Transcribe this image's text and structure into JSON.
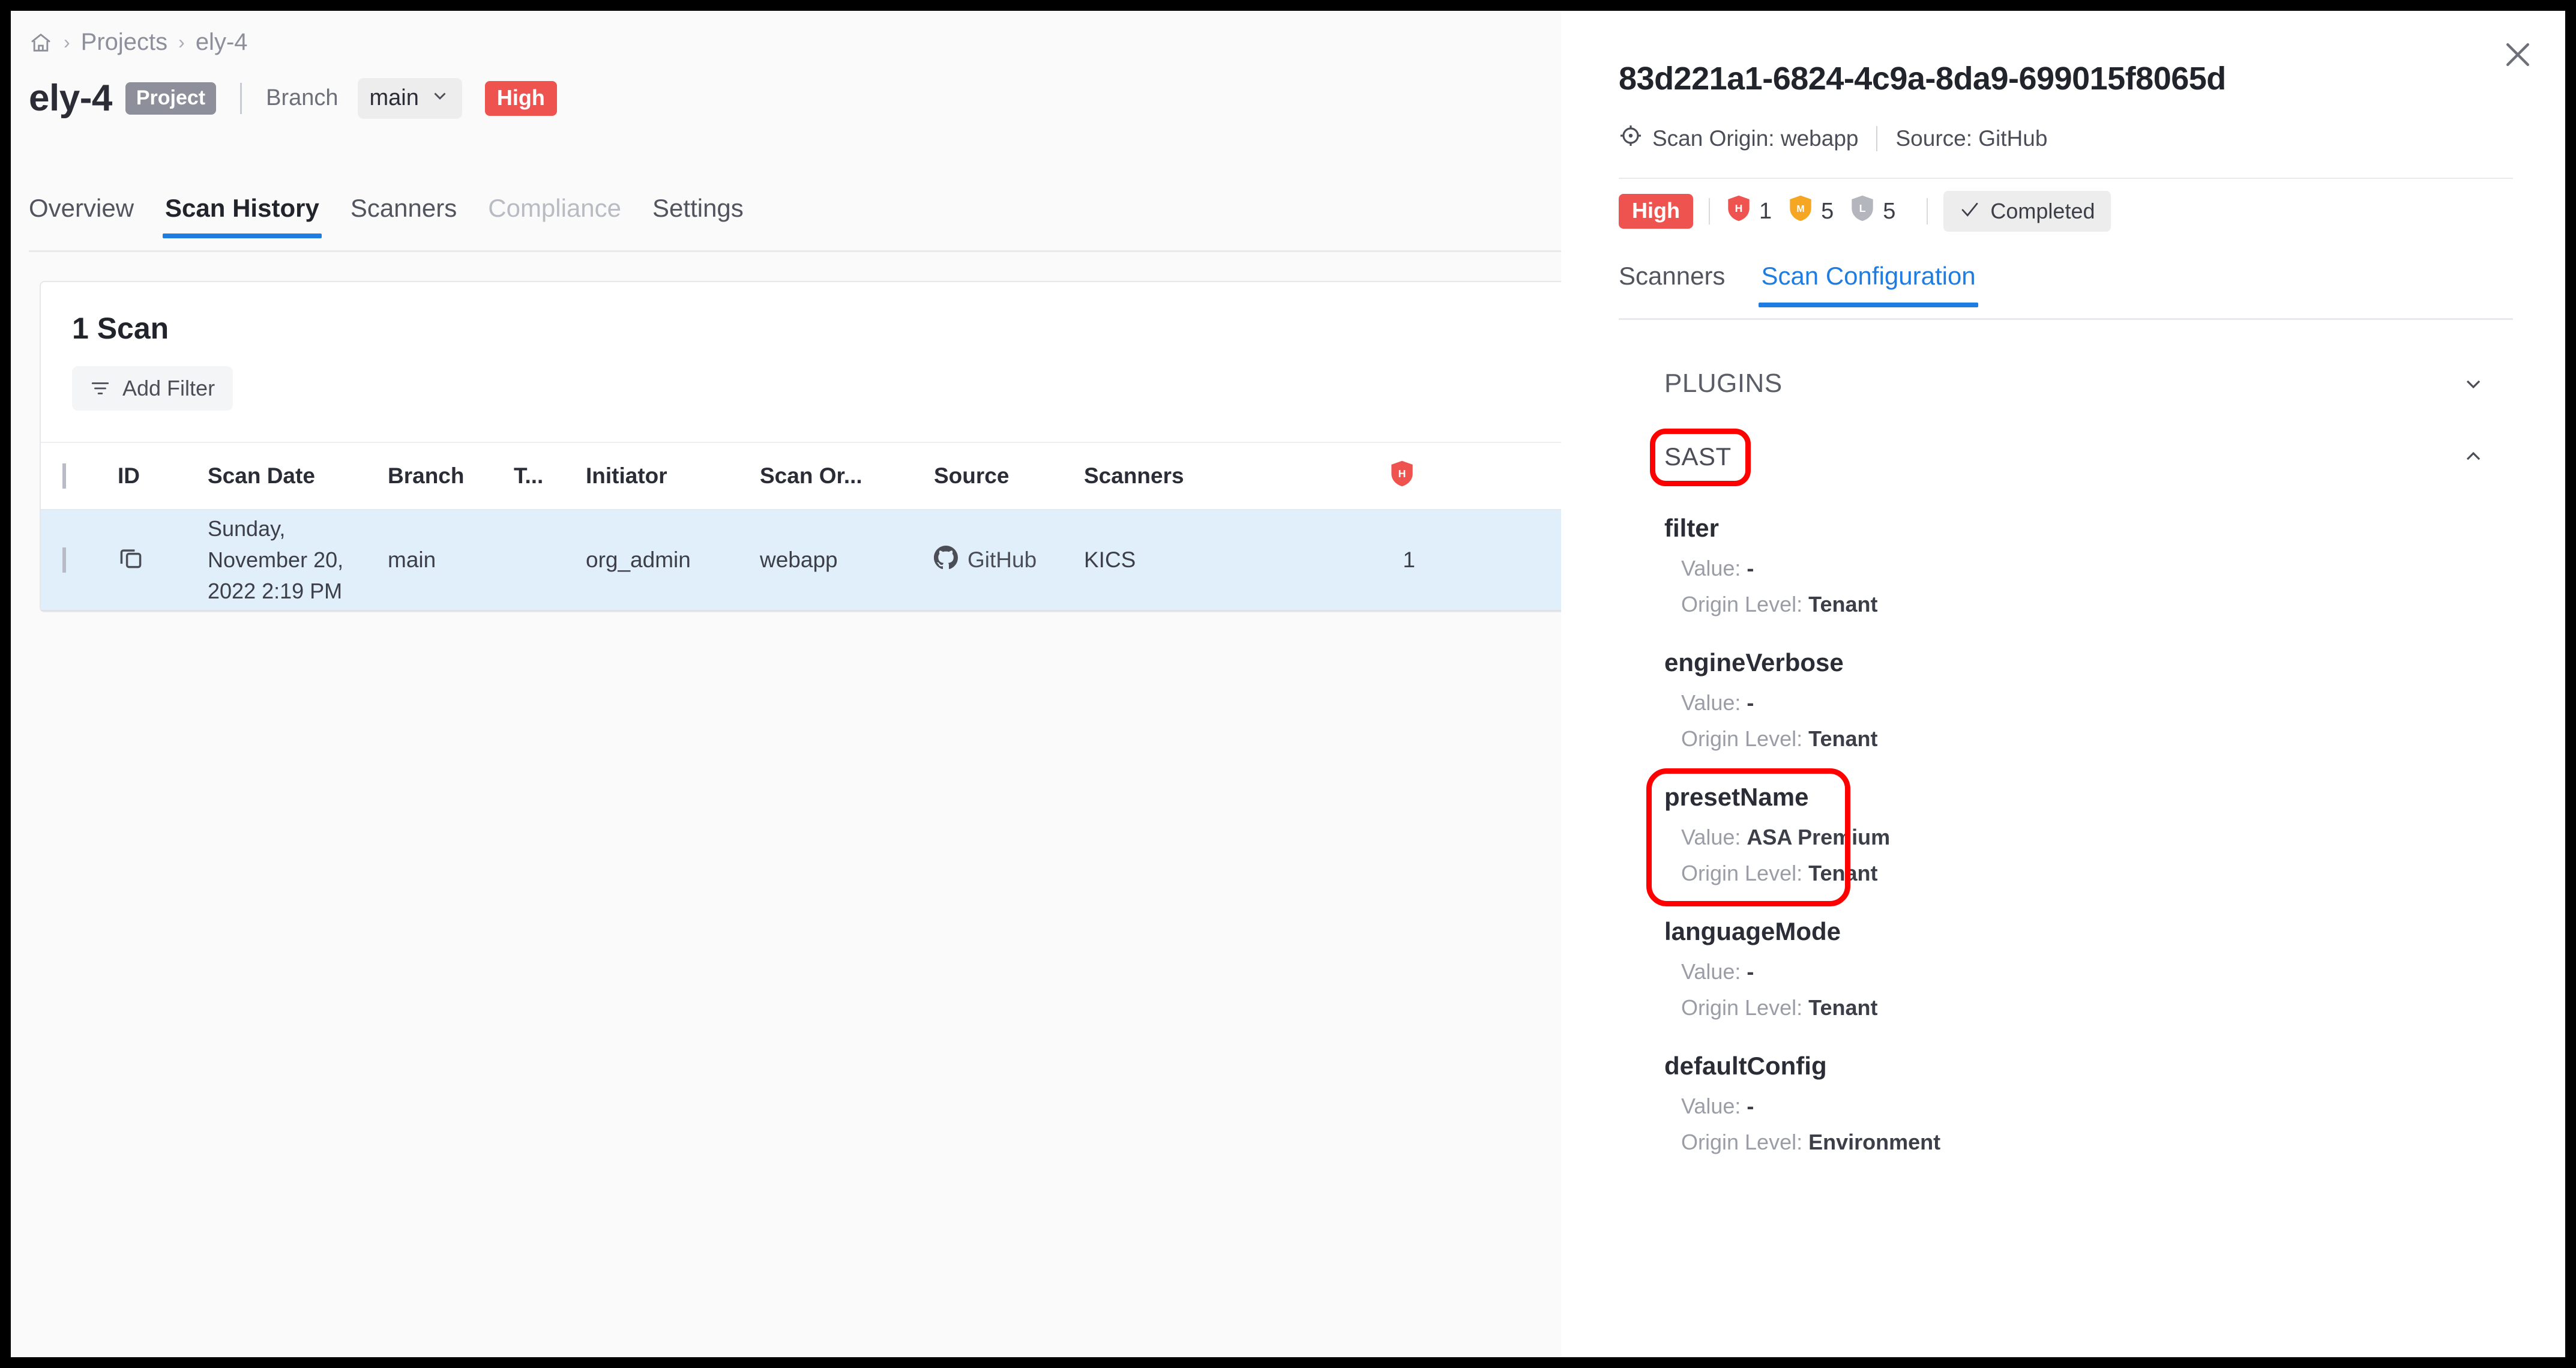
{
  "breadcrumb": {
    "home_icon": "home-icon",
    "items": [
      "Projects",
      "ely-4"
    ],
    "separator": "›"
  },
  "header": {
    "project_name": "ely-4",
    "project_chip": "Project",
    "branch_label": "Branch",
    "branch_value": "main",
    "risk_badge": "High"
  },
  "tabs": [
    {
      "label": "Overview",
      "state": "normal"
    },
    {
      "label": "Scan History",
      "state": "active"
    },
    {
      "label": "Scanners",
      "state": "normal"
    },
    {
      "label": "Compliance",
      "state": "disabled"
    },
    {
      "label": "Settings",
      "state": "normal"
    }
  ],
  "card": {
    "title": "1 Scan",
    "add_filter": "Add Filter",
    "columns": [
      "",
      "ID",
      "Scan Date",
      "Branch",
      "T...",
      "Initiator",
      "Scan Or...",
      "Source",
      "Scanners",
      "H"
    ],
    "rows": [
      {
        "id_icon": "copy-icon",
        "scan_date": "Sunday, November 20, 2022 2:19 PM",
        "branch": "main",
        "t": "",
        "initiator": "org_admin",
        "scan_origin": "webapp",
        "source": "GitHub",
        "source_icon": "github-icon",
        "scanners": "KICS",
        "high": "1"
      }
    ]
  },
  "panel": {
    "close_icon": "close-icon",
    "scan_id": "83d221a1-6824-4c9a-8da9-699015f8065d",
    "origin_icon": "target-icon",
    "scan_origin": "Scan Origin: webapp",
    "source": "Source: GitHub",
    "severity": {
      "risk_badge": "High",
      "high_label": "H",
      "high_count": "1",
      "medium_label": "M",
      "medium_count": "5",
      "low_label": "L",
      "low_count": "5",
      "status": "Completed",
      "status_icon": "check-icon"
    },
    "tabs": [
      {
        "label": "Scanners",
        "state": "normal"
      },
      {
        "label": "Scan Configuration",
        "state": "active"
      }
    ],
    "accordions": [
      {
        "label": "PLUGINS",
        "expanded": false,
        "chevron": "chevron-down-icon"
      },
      {
        "label": "SAST",
        "expanded": true,
        "chevron": "chevron-up-icon",
        "highlighted": true
      }
    ],
    "parameters": [
      {
        "name": "filter",
        "value_label": "Value:",
        "value": "-",
        "origin_label": "Origin Level:",
        "origin": "Tenant",
        "highlighted": false
      },
      {
        "name": "engineVerbose",
        "value_label": "Value:",
        "value": "-",
        "origin_label": "Origin Level:",
        "origin": "Tenant",
        "highlighted": false
      },
      {
        "name": "presetName",
        "value_label": "Value:",
        "value": "ASA Premium",
        "origin_label": "Origin Level:",
        "origin": "Tenant",
        "highlighted": true
      },
      {
        "name": "languageMode",
        "value_label": "Value:",
        "value": "-",
        "origin_label": "Origin Level:",
        "origin": "Tenant",
        "highlighted": false
      },
      {
        "name": "defaultConfig",
        "value_label": "Value:",
        "value": "-",
        "origin_label": "Origin Level:",
        "origin": "Environment",
        "highlighted": false
      }
    ]
  },
  "colors": {
    "accent_blue": "#1f7ce0",
    "risk_high": "#ef5350",
    "severity_medium": "#f5a623",
    "severity_low": "#9b9da6",
    "row_selected": "#e0effa",
    "highlight_annotation": "#ff0000"
  }
}
